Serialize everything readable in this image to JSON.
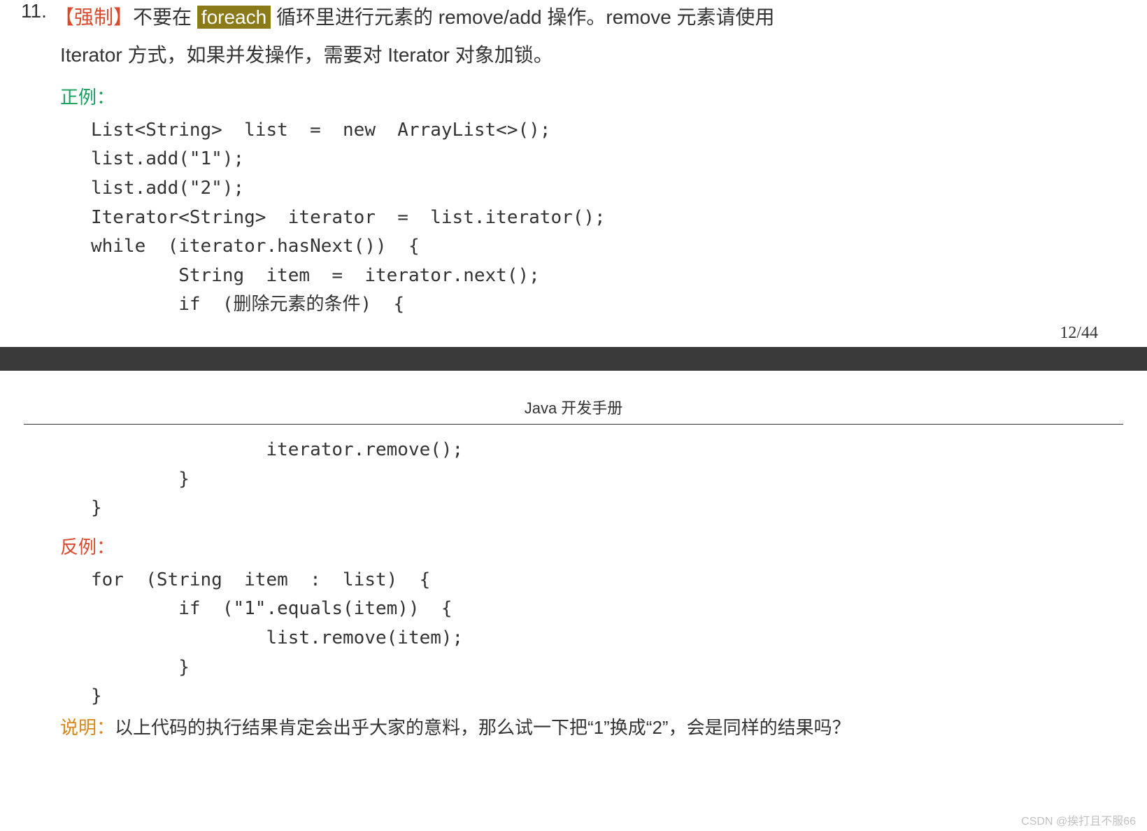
{
  "rule": {
    "number": "11.",
    "mandatory_tag": "【强制】",
    "text_before_highlight": "不要在 ",
    "highlight": "foreach",
    "text_after_highlight": " 循环里进行元素的 remove/add 操作。remove 元素请使用",
    "text_line2": "Iterator 方式，如果并发操作，需要对 Iterator 对象加锁。"
  },
  "positive_label": "正例：",
  "positive_code_top": "List<String>  list  =  new  ArrayList<>();\nlist.add(\"1\");\nlist.add(\"2\");\nIterator<String>  iterator  =  list.iterator();\nwhile  (iterator.hasNext())  {\n        String  item  =  iterator.next();\n        if  (删除元素的条件)  {",
  "page_number": "12/44",
  "manual_title": "Java 开发手册",
  "positive_code_bottom": "                iterator.remove();\n        }\n}",
  "negative_label": "反例：",
  "negative_code": "for  (String  item  :  list)  {\n        if  (\"1\".equals(item))  {\n                list.remove(item);\n        }\n}",
  "explain_label": "说明：",
  "explain_text": "以上代码的执行结果肯定会出乎大家的意料，那么试一下把“1”换成“2”，会是同样的结果吗？",
  "watermark": "CSDN @挨打且不服66"
}
